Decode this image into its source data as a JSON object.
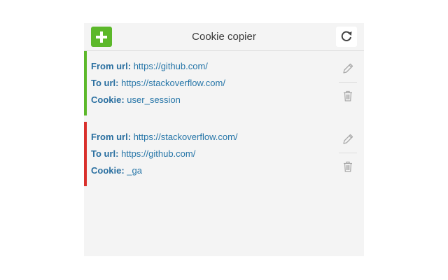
{
  "header": {
    "title": "Cookie copier",
    "add_icon": "plus-icon",
    "refresh_icon": "refresh-icon",
    "add_color": "#5cb82a"
  },
  "rules": [
    {
      "status_color": "#5cb82a",
      "from_label": "From url:",
      "from_url": "https://github.com/",
      "to_label": "To url:",
      "to_url": "https://stackoverflow.com/",
      "cookie_label": "Cookie:",
      "cookie": "user_session",
      "edit_icon": "pencil-icon",
      "delete_icon": "trash-icon"
    },
    {
      "status_color": "#d9302c",
      "from_label": "From url:",
      "from_url": "https://stackoverflow.com/",
      "to_label": "To url:",
      "to_url": "https://github.com/",
      "cookie_label": "Cookie:",
      "cookie": "_ga",
      "edit_icon": "pencil-icon",
      "delete_icon": "trash-icon"
    }
  ]
}
